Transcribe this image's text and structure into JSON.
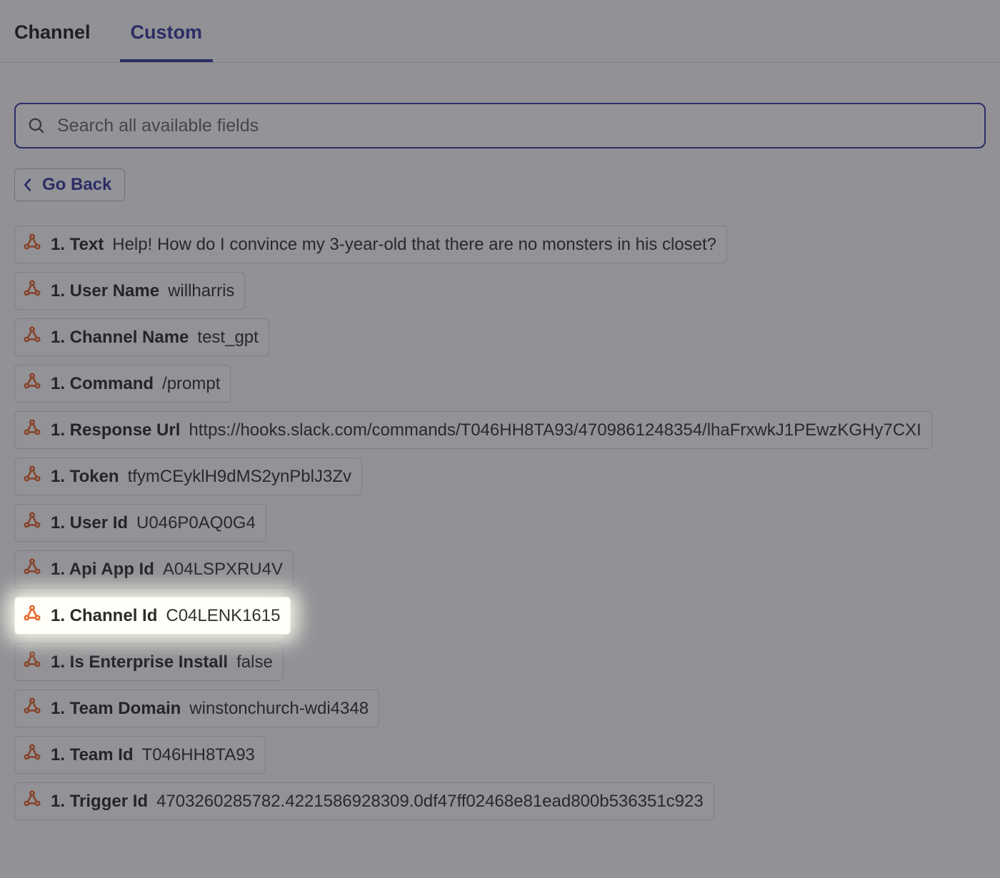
{
  "tabs": {
    "channel": "Channel",
    "custom": "Custom"
  },
  "search": {
    "placeholder": "Search all available fields"
  },
  "go_back_label": "Go Back",
  "field_prefix": "1.",
  "fields": [
    {
      "name": "Text",
      "value": "Help! How do I convince my 3-year-old that there are no monsters in his closet?"
    },
    {
      "name": "User Name",
      "value": "willharris"
    },
    {
      "name": "Channel Name",
      "value": "test_gpt"
    },
    {
      "name": "Command",
      "value": "/prompt"
    },
    {
      "name": "Response Url",
      "value": "https://hooks.slack.com/commands/T046HH8TA93/4709861248354/lhaFrxwkJ1PEwzKGHy7CXI"
    },
    {
      "name": "Token",
      "value": "tfymCEyklH9dMS2ynPblJ3Zv"
    },
    {
      "name": "User Id",
      "value": "U046P0AQ0G4"
    },
    {
      "name": "Api App Id",
      "value": "A04LSPXRU4V"
    },
    {
      "name": "Channel Id",
      "value": "C04LENK1615",
      "highlight": true
    },
    {
      "name": "Is Enterprise Install",
      "value": "false"
    },
    {
      "name": "Team Domain",
      "value": "winstonchurch-wdi4348"
    },
    {
      "name": "Team Id",
      "value": "T046HH8TA93"
    },
    {
      "name": "Trigger Id",
      "value": "4703260285782.4221586928309.0df47ff02468e81ead800b536351c923"
    }
  ]
}
